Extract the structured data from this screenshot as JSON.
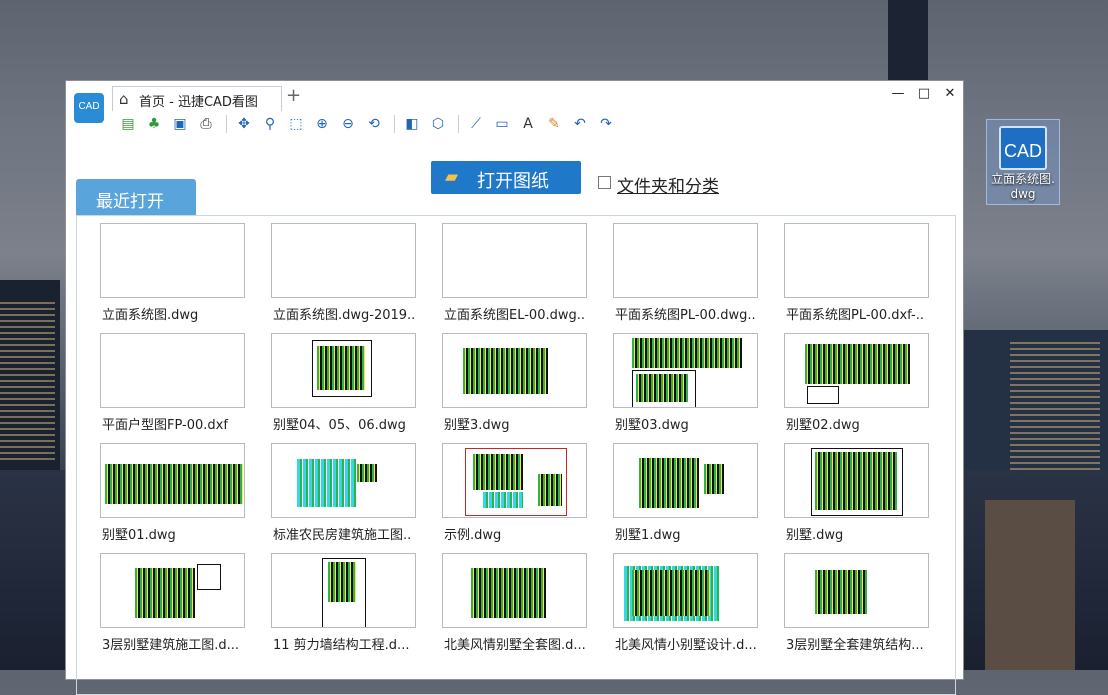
{
  "desktop": {
    "icon": {
      "badge": "CAD",
      "label_line1": "立面系统图.",
      "label_line2": "dwg"
    }
  },
  "window": {
    "logo_text": "CAD",
    "tab_title": "首页 - 迅捷CAD看图",
    "new_tab": "+",
    "controls": {
      "minimize": "—",
      "maximize": "□",
      "close": "✕"
    }
  },
  "toolbar": {
    "icons": [
      "open-file-icon",
      "palm-tree-icon",
      "save-icon",
      "print-icon",
      "pan-icon",
      "zoom-window-icon",
      "zoom-extents-icon",
      "zoom-in-icon",
      "zoom-out-icon",
      "zoom-previous-icon",
      "layer-icon",
      "3d-view-icon",
      "measure-line-icon",
      "measure-rect-icon",
      "text-icon",
      "markup-pen-icon",
      "undo-icon",
      "redo-icon"
    ]
  },
  "main": {
    "open_button_label": "打开图纸",
    "folder_sort_label": "文件夹和分类",
    "recent_tab_label": "最近打开"
  },
  "files": [
    {
      "name": "立面系统图.dwg",
      "thumb": "blank"
    },
    {
      "name": "立面系统图.dwg-2019..",
      "thumb": "blank"
    },
    {
      "name": "立面系统图EL-00.dwg..",
      "thumb": "blank"
    },
    {
      "name": "平面系统图PL-00.dwg..",
      "thumb": "blank"
    },
    {
      "name": "平面系统图PL-00.dxf-..",
      "thumb": "blank"
    },
    {
      "name": "平面户型图FP-00.dxf",
      "thumb": "blank"
    },
    {
      "name": "别墅04、05、06.dwg",
      "thumb": "plan"
    },
    {
      "name": "别墅3.dwg",
      "thumb": "plan"
    },
    {
      "name": "别墅03.dwg",
      "thumb": "plan"
    },
    {
      "name": "别墅02.dwg",
      "thumb": "plan"
    },
    {
      "name": "别墅01.dwg",
      "thumb": "plan"
    },
    {
      "name": "标准农民房建筑施工图..",
      "thumb": "plan"
    },
    {
      "name": "示例.dwg",
      "thumb": "plan"
    },
    {
      "name": "别墅1.dwg",
      "thumb": "plan"
    },
    {
      "name": "别墅.dwg",
      "thumb": "plan"
    },
    {
      "name": "3层别墅建筑施工图.d...",
      "thumb": "plan"
    },
    {
      "name": "11 剪力墙结构工程.d...",
      "thumb": "plan"
    },
    {
      "name": "北美风情别墅全套图.d...",
      "thumb": "plan"
    },
    {
      "name": "北美风情小别墅设计.d...",
      "thumb": "plan"
    },
    {
      "name": "3层别墅全套建筑结构...",
      "thumb": "plan"
    }
  ]
}
